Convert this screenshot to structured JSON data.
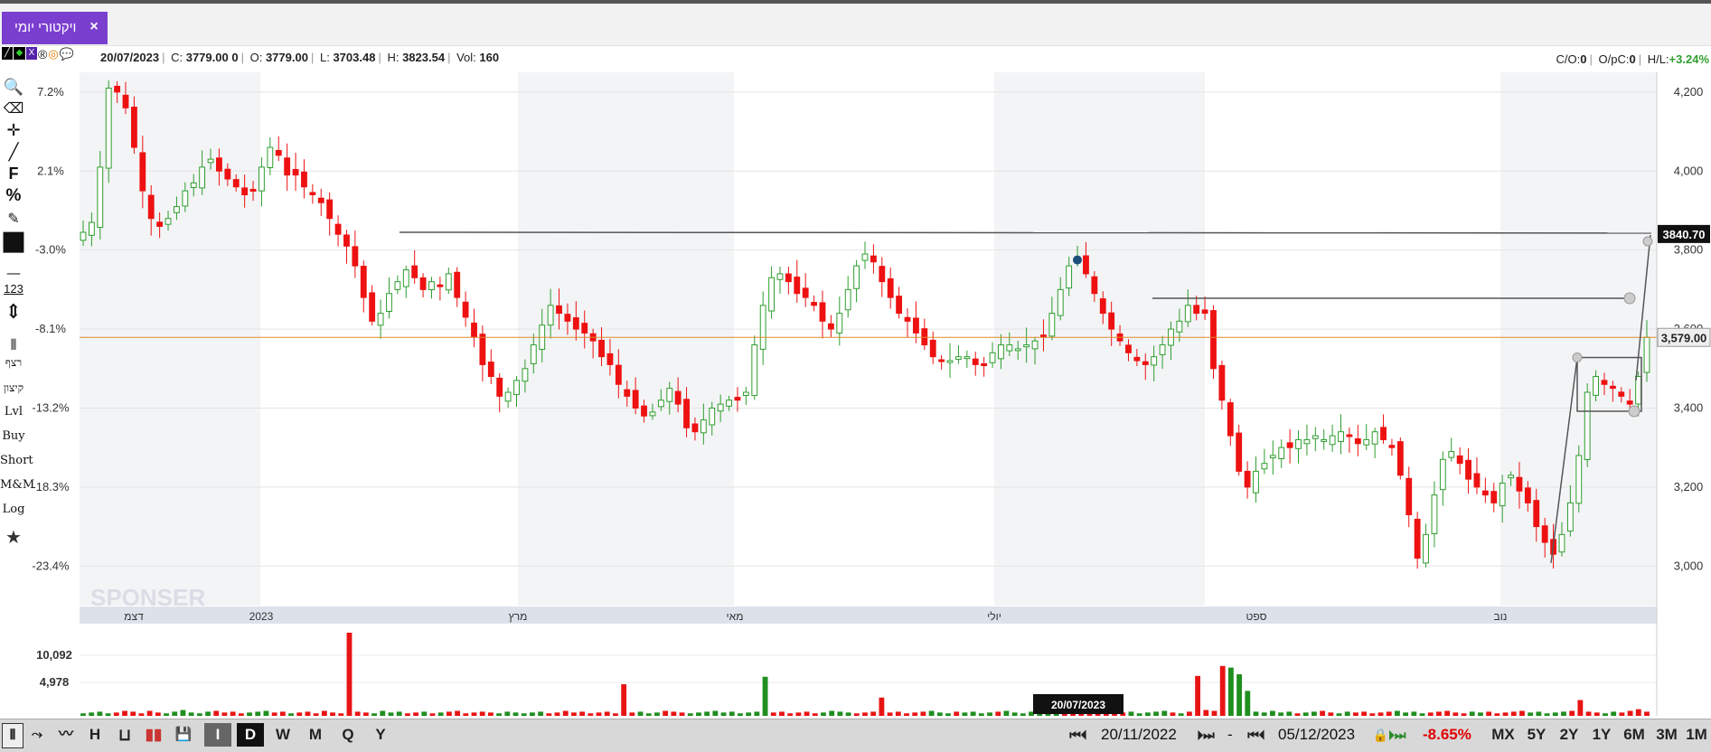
{
  "tab": {
    "label": "ויקטורי יומי",
    "close": "×"
  },
  "info": {
    "date": "20/07/2023",
    "c_label": "C:",
    "c_value": "3779.00",
    "c_extra": "0",
    "o_label": "O:",
    "o_value": "3779.00",
    "l_label": "L:",
    "l_value": "3703.48",
    "h_label": "H:",
    "h_value": "3823.54",
    "vol_label": "Vol:",
    "vol_value": "160",
    "co_label": "C/O:",
    "co_value": "0",
    "opc_label": "O/pC:",
    "opc_value": "0",
    "hl_label": "H/L:",
    "hl_value": "+3.24%"
  },
  "left_tools": [
    {
      "name": "search-icon",
      "glyph": "🔍"
    },
    {
      "name": "eraser-icon",
      "glyph": "⌫"
    },
    {
      "name": "crosshair-icon",
      "glyph": "✛"
    },
    {
      "name": "line-tool-icon",
      "glyph": "╱"
    },
    {
      "name": "fibonacci-icon",
      "glyph": "F"
    },
    {
      "name": "percent-icon",
      "glyph": "%"
    },
    {
      "name": "edit-icon",
      "glyph": "✎"
    },
    {
      "name": "color-swatch-icon",
      "glyph": "■"
    },
    {
      "name": "line-style-icon",
      "glyph": "—"
    },
    {
      "name": "numbers-icon",
      "glyph": "123"
    },
    {
      "name": "measure-icon",
      "glyph": "⇕"
    },
    {
      "name": "candle-icon",
      "glyph": "⫴"
    }
  ],
  "left_text_tools": [
    "רצף",
    "קיצון",
    "Lvl",
    "Buy",
    "Short",
    "M&M",
    "Log"
  ],
  "star": "★",
  "chart_data": {
    "type": "candlestick",
    "price_axis": {
      "ticks": [
        3000,
        3200,
        3400,
        3600,
        3800,
        4000,
        4200
      ],
      "labels": [
        "3,000",
        "3,200",
        "3,400",
        "3,600",
        "3,800",
        "4,000",
        "4,200"
      ],
      "range": [
        2900,
        4250
      ]
    },
    "percent_axis": {
      "labels": [
        "7.2%",
        "2.1%",
        "-3.0%",
        "-8.1%",
        "-13.2%",
        "-18.3%",
        "-23.4%"
      ]
    },
    "x_labels": [
      "דצמ",
      "2023",
      "מרץ",
      "מאי",
      "יולי",
      "ספט",
      "נוב"
    ],
    "current_price_label": "3,579.00",
    "current_price": 3579,
    "level_line_label": "3840.70",
    "level_line": 3840.7,
    "volume_axis": {
      "labels": [
        "10,092",
        "4,978"
      ]
    },
    "closes": [
      3845,
      3870,
      4010,
      4210,
      4200,
      4160,
      4060,
      3950,
      3880,
      3860,
      3880,
      3910,
      3950,
      3970,
      4010,
      4030,
      4000,
      3980,
      3960,
      3940,
      3950,
      4010,
      4060,
      4040,
      3990,
      3990,
      3960,
      3940,
      3920,
      3880,
      3840,
      3810,
      3760,
      3680,
      3620,
      3640,
      3690,
      3720,
      3750,
      3730,
      3700,
      3720,
      3710,
      3740,
      3680,
      3630,
      3580,
      3510,
      3480,
      3430,
      3440,
      3470,
      3500,
      3560,
      3610,
      3660,
      3640,
      3620,
      3600,
      3590,
      3570,
      3530,
      3510,
      3460,
      3430,
      3400,
      3380,
      3390,
      3420,
      3450,
      3410,
      3350,
      3340,
      3370,
      3400,
      3410,
      3420,
      3420,
      3440,
      3560,
      3660,
      3730,
      3740,
      3720,
      3690,
      3680,
      3660,
      3620,
      3600,
      3640,
      3700,
      3760,
      3790,
      3770,
      3720,
      3680,
      3640,
      3620,
      3590,
      3560,
      3530,
      3520,
      3520,
      3530,
      3530,
      3510,
      3510,
      3540,
      3560,
      3560,
      3550,
      3560,
      3570,
      3580,
      3640,
      3700,
      3760,
      3780,
      3740,
      3690,
      3640,
      3600,
      3570,
      3540,
      3520,
      3510,
      3530,
      3560,
      3600,
      3620,
      3660,
      3640,
      3640,
      3500,
      3420,
      3330,
      3240,
      3200,
      3240,
      3260,
      3280,
      3300,
      3300,
      3320,
      3320,
      3330,
      3320,
      3330,
      3340,
      3330,
      3310,
      3320,
      3340,
      3320,
      3300,
      3230,
      3130,
      3020,
      3080,
      3180,
      3270,
      3290,
      3260,
      3220,
      3200,
      3180,
      3160,
      3210,
      3230,
      3190,
      3160,
      3100,
      3060,
      3030,
      3080,
      3160,
      3280,
      3440,
      3480,
      3460,
      3450,
      3430,
      3410,
      3480,
      3579
    ],
    "volumes": [
      0.03,
      0.04,
      0.05,
      0.03,
      0.04,
      0.06,
      0.05,
      0.03,
      0.06,
      0.04,
      0.03,
      0.05,
      0.07,
      0.04,
      0.03,
      0.05,
      0.06,
      0.04,
      0.05,
      0.03,
      0.04,
      0.05,
      0.06,
      0.04,
      0.05,
      0.03,
      0.04,
      0.05,
      0.03,
      0.06,
      0.04,
      0.03,
      1.0,
      0.05,
      0.04,
      0.03,
      0.06,
      0.04,
      0.05,
      0.03,
      0.04,
      0.05,
      0.03,
      0.04,
      0.05,
      0.06,
      0.03,
      0.04,
      0.05,
      0.04,
      0.03,
      0.05,
      0.04,
      0.03,
      0.04,
      0.05,
      0.03,
      0.04,
      0.06,
      0.04,
      0.05,
      0.03,
      0.04,
      0.05,
      0.03,
      0.38,
      0.04,
      0.05,
      0.03,
      0.04,
      0.06,
      0.05,
      0.04,
      0.03,
      0.04,
      0.05,
      0.06,
      0.04,
      0.05,
      0.03,
      0.04,
      0.05,
      0.47,
      0.04,
      0.05,
      0.03,
      0.04,
      0.05,
      0.03,
      0.04,
      0.06,
      0.05,
      0.04,
      0.03,
      0.04,
      0.05,
      0.22,
      0.04,
      0.05,
      0.03,
      0.04,
      0.05,
      0.06,
      0.04,
      0.03,
      0.05,
      0.04,
      0.05,
      0.03,
      0.04,
      0.05,
      0.06,
      0.04,
      0.03,
      0.05,
      0.04,
      0.03,
      0.05,
      0.06,
      0.04,
      0.05,
      0.03,
      0.04,
      0.05,
      0.06,
      0.04,
      0.05,
      0.03,
      0.04,
      0.05,
      0.06,
      0.04,
      0.03,
      0.05,
      0.48,
      0.07,
      0.06,
      0.6,
      0.58,
      0.5,
      0.3,
      0.05,
      0.04,
      0.06,
      0.04,
      0.05,
      0.03,
      0.04,
      0.05,
      0.06,
      0.04,
      0.03,
      0.05,
      0.04,
      0.05,
      0.03,
      0.04,
      0.05,
      0.06,
      0.04,
      0.05,
      0.03,
      0.04,
      0.05,
      0.06,
      0.04,
      0.03,
      0.05,
      0.04,
      0.05,
      0.03,
      0.04,
      0.05,
      0.06,
      0.04,
      0.05,
      0.03,
      0.04,
      0.05,
      0.06,
      0.19,
      0.05,
      0.04,
      0.03,
      0.05,
      0.04,
      0.06,
      0.08,
      0.05
    ]
  },
  "bottom": {
    "date_tooltip": "20/07/2023",
    "period_buttons": [
      "I",
      "D",
      "W",
      "M",
      "Q",
      "Y"
    ],
    "start_date": "20/11/2022",
    "dash": "-",
    "end_date": "05/12/2023",
    "change": "-8.65%",
    "range_buttons": [
      "MX",
      "5Y",
      "2Y",
      "1Y",
      "6M",
      "3M",
      "1M"
    ]
  },
  "colors": {
    "up": "#2e9e2e",
    "down": "#ee1111",
    "accent": "#7b3fd0",
    "orange_line": "#e08a2c"
  }
}
